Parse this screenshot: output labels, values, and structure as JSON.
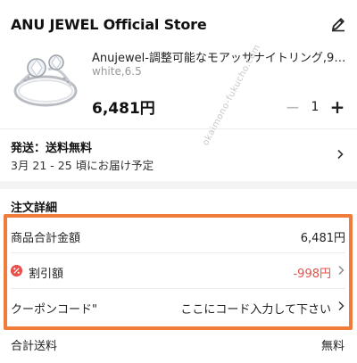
{
  "store": {
    "name": "ANU JEWEL Official Store",
    "edit_icon": "pencil-icon"
  },
  "product": {
    "title": "Anujewel-調整可能なモアッサナイトリング,925ス...",
    "variant": "white,6.5",
    "price": "6,481円",
    "quantity": "1",
    "minus_label": "−",
    "plus_label": "+",
    "image_icon": "ring-image"
  },
  "shipping": {
    "label": "発送：送料無料",
    "delivery": "3月 21 - 25 頃にお届け予定"
  },
  "watermark": "okaimono-fukucho.com",
  "order_details": {
    "heading": "注文詳細",
    "subtotal_label": "商品合計金額",
    "subtotal_value": "6,481円",
    "discount_label": "割引額",
    "discount_icon_text": "%",
    "discount_value": "-998円",
    "coupon_label": "クーポンコード\"",
    "coupon_placeholder": "ここにコード入力して下さい"
  },
  "total_shipping": {
    "label": "合計送料",
    "value": "無料"
  },
  "colors": {
    "highlight": "#ef7c3a",
    "discount": "#e8504a"
  }
}
